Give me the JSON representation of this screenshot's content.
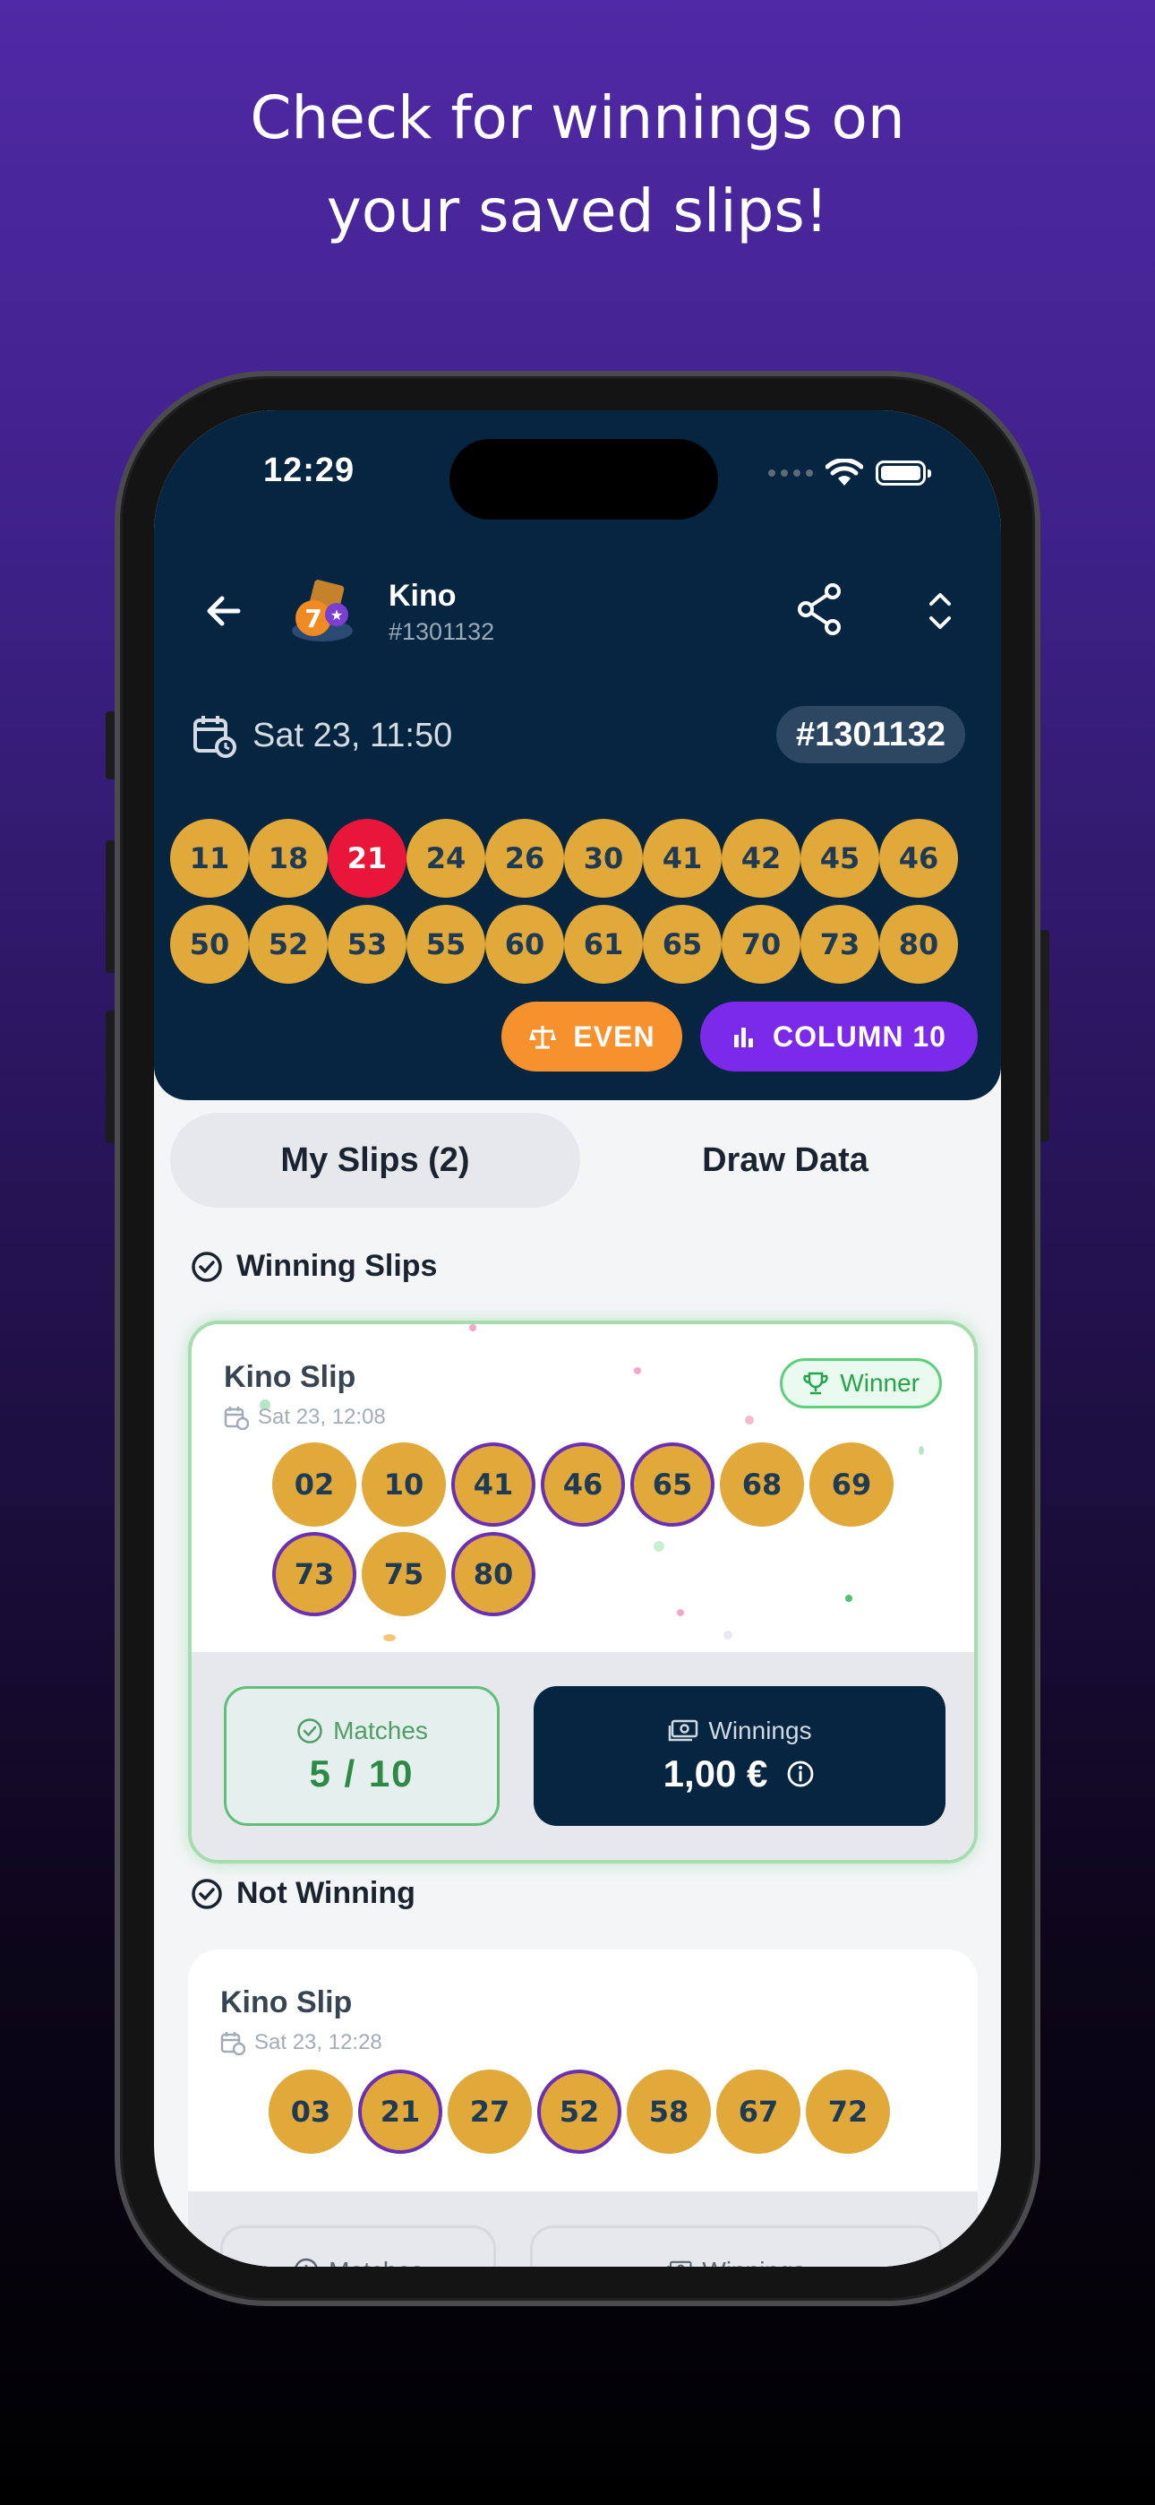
{
  "headline": {
    "line1": "Check for winnings on",
    "line2": "your saved slips!"
  },
  "status_bar": {
    "time": "12:29"
  },
  "header": {
    "title": "Kino",
    "subtitle": "#1301132"
  },
  "draw": {
    "date": "Sat 23, 11:50",
    "badge": "#1301132",
    "numbers": [
      "11",
      "18",
      "21",
      "24",
      "26",
      "30",
      "41",
      "42",
      "45",
      "46",
      "50",
      "52",
      "53",
      "55",
      "60",
      "61",
      "65",
      "70",
      "73",
      "80"
    ],
    "highlighted": [
      "21"
    ],
    "even_label": "EVEN",
    "column_label": "COLUMN 10"
  },
  "tabs": {
    "my_slips": "My Slips (2)",
    "draw_data": "Draw Data"
  },
  "sections": {
    "winning": "Winning Slips",
    "not_winning": "Not Winning"
  },
  "slips": [
    {
      "title": "Kino Slip",
      "date": "Sat 23, 12:08",
      "badge": "Winner",
      "numbers": [
        "02",
        "10",
        "41",
        "46",
        "65",
        "68",
        "69",
        "73",
        "75",
        "80"
      ],
      "matched": [
        "41",
        "46",
        "65",
        "73",
        "80"
      ],
      "matches_label": "Matches",
      "matches_value": "5 / 10",
      "winnings_label": "Winnings",
      "winnings_value": "1,00 €"
    },
    {
      "title": "Kino Slip",
      "date": "Sat 23, 12:28",
      "numbers": [
        "03",
        "21",
        "27",
        "52",
        "58",
        "67",
        "72"
      ],
      "matched": [
        "21",
        "52"
      ],
      "matches_label": "Matches",
      "winnings_label": "Winnings"
    }
  ],
  "colors": {
    "background_top": "#5029a6",
    "panel": "#062541",
    "ball": "#e0a93a",
    "drawn_hit": "#e8173a",
    "even_pill": "#f6912e",
    "column_pill": "#7a2ae8",
    "winner_green": "#27a34a",
    "match_ring": "#6a2fb4"
  },
  "icons": {
    "back": "arrow-left-icon",
    "logo": "kino-logo-icon",
    "share": "share-icon",
    "expand": "expand-icon",
    "calendar": "calendar-icon",
    "even": "scale-icon",
    "column": "bar-chart-icon",
    "trophy": "trophy-icon",
    "check": "check-circle-icon",
    "money": "banknote-icon",
    "info": "info-icon"
  }
}
